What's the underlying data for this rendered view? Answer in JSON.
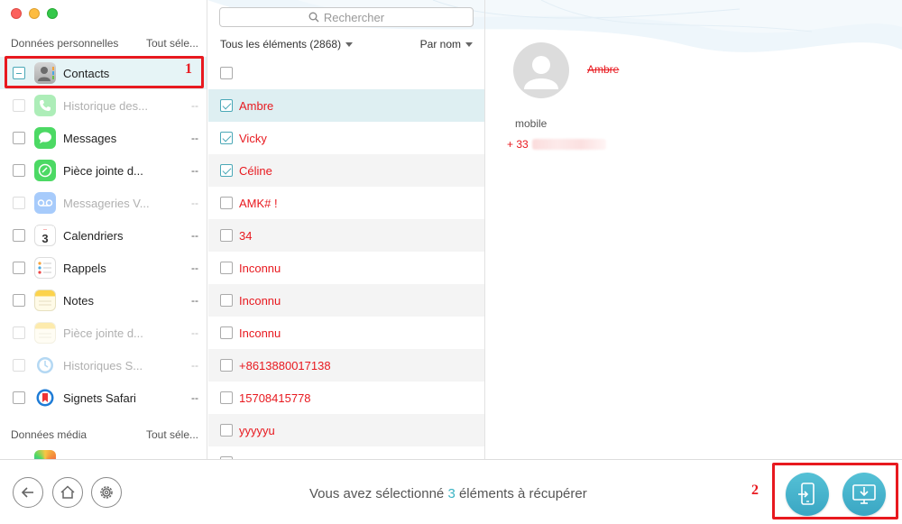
{
  "sidebar": {
    "personal_header": "Données personnelles",
    "select_all": "Tout séle...",
    "media_header": "Données média",
    "items": [
      {
        "label": "Contacts",
        "count": "",
        "icon": "contacts-icon",
        "state": "active"
      },
      {
        "label": "Historique des...",
        "count": "--",
        "icon": "phone-icon",
        "state": "disabled"
      },
      {
        "label": "Messages",
        "count": "--",
        "icon": "messages-icon",
        "state": "normal"
      },
      {
        "label": "Pièce jointe d...",
        "count": "--",
        "icon": "attachment-icon",
        "state": "normal"
      },
      {
        "label": "Messageries V...",
        "count": "--",
        "icon": "voicemail-icon",
        "state": "disabled"
      },
      {
        "label": "Calendriers",
        "count": "--",
        "icon": "calendar-icon",
        "state": "normal"
      },
      {
        "label": "Rappels",
        "count": "--",
        "icon": "reminders-icon",
        "state": "normal"
      },
      {
        "label": "Notes",
        "count": "--",
        "icon": "notes-icon",
        "state": "normal"
      },
      {
        "label": "Pièce jointe d...",
        "count": "--",
        "icon": "notes-attachment-icon",
        "state": "disabled"
      },
      {
        "label": "Historiques S...",
        "count": "--",
        "icon": "safari-history-icon",
        "state": "disabled"
      },
      {
        "label": "Signets Safari",
        "count": "--",
        "icon": "safari-bookmarks-icon",
        "state": "normal"
      }
    ]
  },
  "list": {
    "search_placeholder": "Rechercher",
    "filter_label": "Tous les éléments (2868)",
    "sort_label": "Par nom",
    "rows": [
      {
        "name": "",
        "checked": false
      },
      {
        "name": "Ambre",
        "checked": true
      },
      {
        "name": "Vicky",
        "checked": true
      },
      {
        "name": "Céline",
        "checked": true
      },
      {
        "name": "AMK# !",
        "checked": false
      },
      {
        "name": "34",
        "checked": false
      },
      {
        "name": "Inconnu",
        "checked": false
      },
      {
        "name": "Inconnu",
        "checked": false
      },
      {
        "name": "Inconnu",
        "checked": false
      },
      {
        "name": "+8613880017138",
        "checked": false
      },
      {
        "name": "15708415778",
        "checked": false
      },
      {
        "name": "yyyyyu",
        "checked": false
      }
    ]
  },
  "detail": {
    "name": "Ambre",
    "field_label": "mobile",
    "phone_prefix": "+ 33"
  },
  "bottom": {
    "status_prefix": "Vous avez sélectionné",
    "status_count": "3",
    "status_suffix": "éléments à récupérer"
  },
  "annotations": {
    "first": "1",
    "second": "2"
  },
  "colors": {
    "accent": "#3bb3c3",
    "deleted": "#e8191f",
    "annotation": "#e8191f",
    "selection": "#deeff2"
  }
}
